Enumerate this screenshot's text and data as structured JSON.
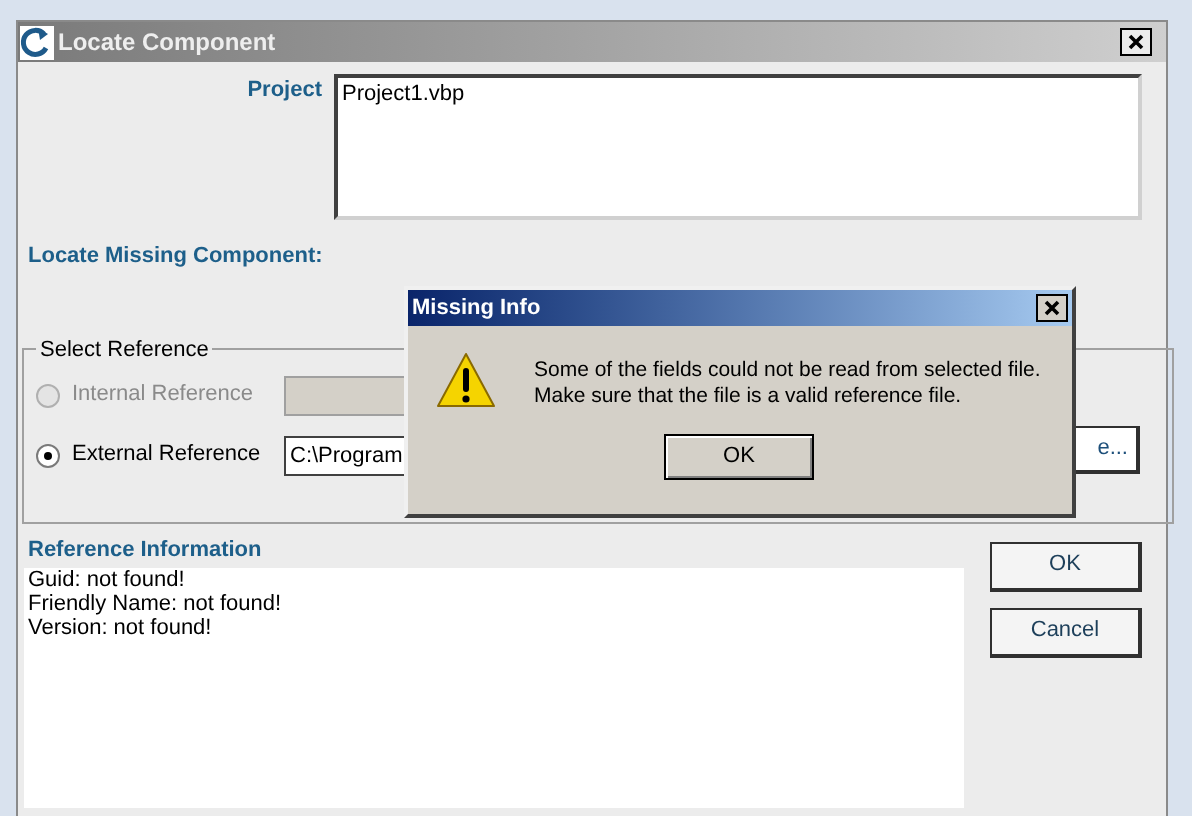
{
  "dialog": {
    "title": "Locate Component",
    "project": {
      "label": "Project",
      "value": "Project1.vbp"
    },
    "locate_label": "Locate Missing Component:",
    "select_reference": {
      "title": "Select Reference",
      "options": [
        {
          "label": "Internal Reference",
          "selected": false,
          "disabled": true
        },
        {
          "label": "External Reference",
          "selected": true,
          "disabled": false,
          "path": "C:\\Program"
        }
      ],
      "browse_button": "e..."
    },
    "reference_information": {
      "label": "Reference Information",
      "lines": [
        "Guid: not found!",
        "Friendly Name: not found!",
        "Version: not found!"
      ]
    },
    "buttons": [
      "OK",
      "Cancel"
    ]
  },
  "message_box": {
    "title": "Missing Info",
    "lines": [
      "Some of the fields could not be read from selected file.",
      "Make sure that the file is a valid reference file."
    ],
    "button": "OK"
  }
}
